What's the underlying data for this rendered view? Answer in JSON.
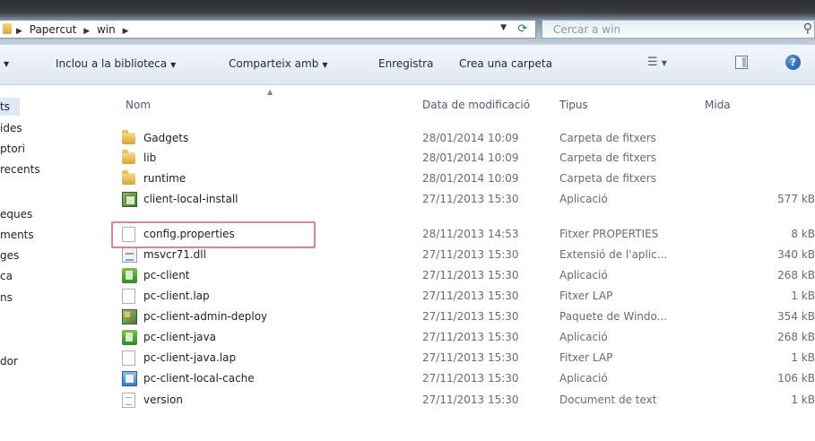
{
  "address": {
    "crumbs": [
      "Papercut",
      "win"
    ],
    "search_placeholder": "Cercar a win"
  },
  "toolbar": {
    "include_library": "Inclou a la biblioteca",
    "share_with": "Comparteix amb",
    "burn": "Enregistra",
    "new_folder": "Crea una carpeta"
  },
  "nav": {
    "items": [
      "ts",
      "ides",
      "ptori",
      "recents",
      "eques",
      "ments",
      "ges",
      "ca",
      "ns",
      "dor"
    ]
  },
  "columns": {
    "name": "Nom",
    "modified": "Data de modificació",
    "type": "Tipus",
    "size": "Mida"
  },
  "files": [
    {
      "name": "Gadgets",
      "date": "28/01/2014 10:09",
      "type": "Carpeta de fitxers",
      "size": "",
      "icon": "folder-icon"
    },
    {
      "name": "lib",
      "date": "28/01/2014 10:09",
      "type": "Carpeta de fitxers",
      "size": "",
      "icon": "folder-icon"
    },
    {
      "name": "runtime",
      "date": "28/01/2014 10:09",
      "type": "Carpeta de fitxers",
      "size": "",
      "icon": "folder-icon"
    },
    {
      "name": "client-local-install",
      "date": "27/11/2013 15:30",
      "type": "Aplicació",
      "size": "577 kB",
      "icon": "application-icon"
    },
    {
      "name": "config.properties",
      "date": "28/11/2013 14:53",
      "type": "Fitxer PROPERTIES",
      "size": "8 kB",
      "icon": "file-icon"
    },
    {
      "name": "msvcr71.dll",
      "date": "27/11/2013 15:30",
      "type": "Extensió de l'aplic...",
      "size": "340 kB",
      "icon": "dll-icon"
    },
    {
      "name": "pc-client",
      "date": "27/11/2013 15:30",
      "type": "Aplicació",
      "size": "268 kB",
      "icon": "pc-client-icon"
    },
    {
      "name": "pc-client.lap",
      "date": "27/11/2013 15:30",
      "type": "Fitxer LAP",
      "size": "1 kB",
      "icon": "file-icon"
    },
    {
      "name": "pc-client-admin-deploy",
      "date": "27/11/2013 15:30",
      "type": "Paquete de Windo...",
      "size": "354 kB",
      "icon": "installer-icon"
    },
    {
      "name": "pc-client-java",
      "date": "27/11/2013 15:30",
      "type": "Aplicació",
      "size": "268 kB",
      "icon": "pc-client-icon"
    },
    {
      "name": "pc-client-java.lap",
      "date": "27/11/2013 15:30",
      "type": "Fitxer LAP",
      "size": "1 kB",
      "icon": "file-icon"
    },
    {
      "name": "pc-client-local-cache",
      "date": "27/11/2013 15:30",
      "type": "Aplicació",
      "size": "106 kB",
      "icon": "cache-app-icon"
    },
    {
      "name": "version",
      "date": "27/11/2013 15:30",
      "type": "Document de text",
      "size": "1 kB",
      "icon": "text-document-icon"
    }
  ],
  "highlighted_file": "config.properties"
}
